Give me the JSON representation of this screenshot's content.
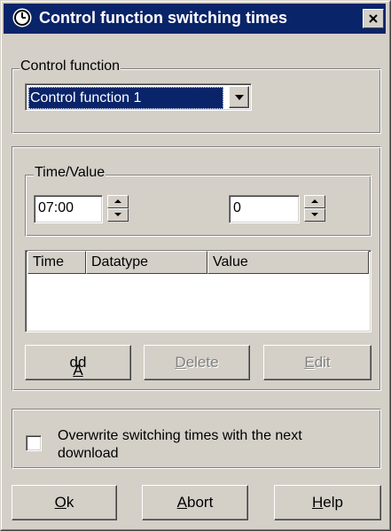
{
  "window": {
    "title": "Control function switching times",
    "icon": "clock-icon",
    "close_icon": "close-icon"
  },
  "control_function": {
    "group_label": "Control function",
    "selected": "Control function 1"
  },
  "time_value": {
    "group_label": "Time/Value",
    "time": "07:00",
    "value": "0"
  },
  "table": {
    "columns": [
      "Time",
      "Datatype",
      "Value"
    ],
    "rows": []
  },
  "actions": {
    "add": {
      "pre": "",
      "mnemonic": "A",
      "post": "dd",
      "enabled": true
    },
    "delete": {
      "pre": "",
      "mnemonic": "D",
      "post": "elete",
      "enabled": false
    },
    "edit": {
      "pre": "",
      "mnemonic": "E",
      "post": "dit",
      "enabled": false
    }
  },
  "overwrite": {
    "label": "Overwrite switching times with the next download",
    "checked": false
  },
  "footer": {
    "ok": {
      "mnemonic": "O",
      "post": "k"
    },
    "abort": {
      "mnemonic": "A",
      "post": "bort"
    },
    "help": {
      "mnemonic": "H",
      "post": "elp"
    }
  },
  "colors": {
    "title_bar": "#0a246a",
    "face": "#d4d0c8",
    "selection": "#0a246a"
  }
}
